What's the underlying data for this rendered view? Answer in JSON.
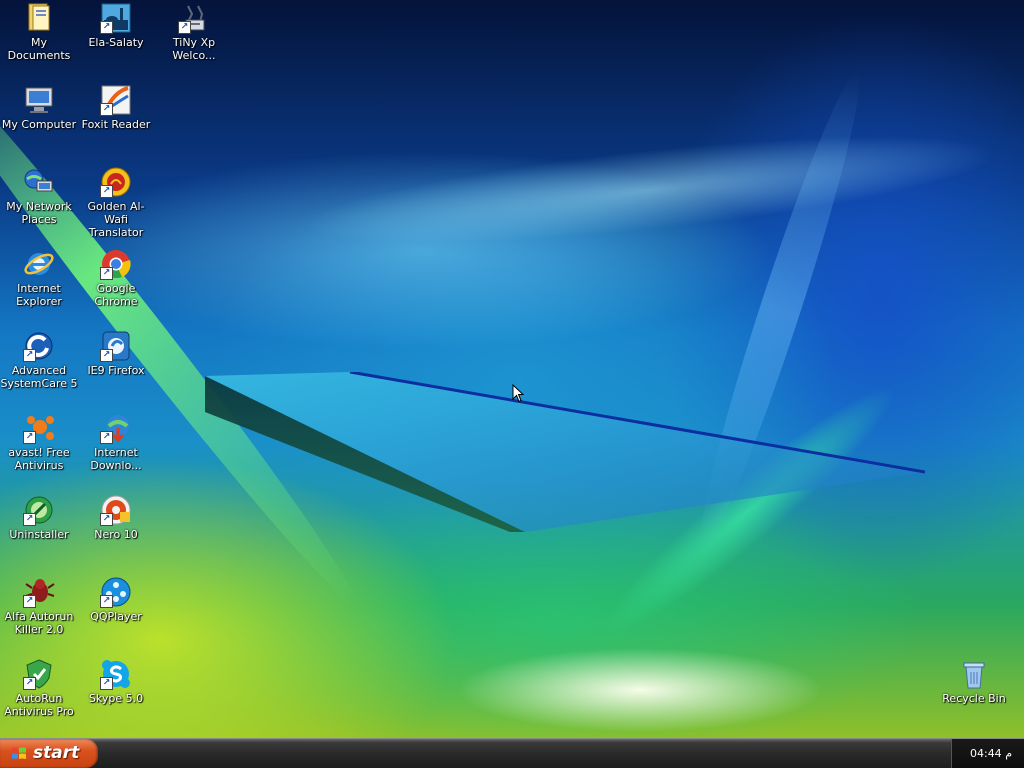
{
  "desktop": {
    "icons_col1": [
      {
        "label": "My Documents",
        "icon": "folder-documents-icon"
      },
      {
        "label": "My Computer",
        "icon": "computer-icon"
      },
      {
        "label": "My Network\nPlaces",
        "icon": "network-places-icon"
      },
      {
        "label": "Internet\nExplorer",
        "icon": "internet-explorer-icon"
      },
      {
        "label": "Advanced\nSystemCare 5",
        "icon": "advanced-systemcare-icon"
      },
      {
        "label": "avast! Free\nAntivirus",
        "icon": "avast-icon"
      },
      {
        "label": "Uninstaller",
        "icon": "uninstaller-icon"
      },
      {
        "label": "Alfa Autorun\nKiller 2.0",
        "icon": "alfa-autorun-icon"
      },
      {
        "label": "AutoRun\nAntivirus Pro",
        "icon": "autorun-antivirus-icon"
      }
    ],
    "icons_col2": [
      {
        "label": "Ela-Salaty",
        "icon": "ela-salaty-icon"
      },
      {
        "label": "Foxit Reader",
        "icon": "foxit-reader-icon"
      },
      {
        "label": "Golden Al-Wafi\nTranslator",
        "icon": "golden-alwafi-icon"
      },
      {
        "label": "Google Chrome",
        "icon": "chrome-icon"
      },
      {
        "label": "IE9 Firefox",
        "icon": "ie9-firefox-icon"
      },
      {
        "label": "Internet\nDownlo...",
        "icon": "internet-download-icon"
      },
      {
        "label": "Nero 10",
        "icon": "nero-icon"
      },
      {
        "label": "QQPlayer",
        "icon": "qqplayer-icon"
      },
      {
        "label": "Skype 5.0",
        "icon": "skype-icon"
      }
    ],
    "icons_col3": [
      {
        "label": "TiNy Xp\nWelco...",
        "icon": "tiny-xp-welcome-icon"
      }
    ],
    "recycle_bin": {
      "label": "Recycle Bin",
      "icon": "recycle-bin-icon"
    }
  },
  "taskbar": {
    "start_label": "start",
    "clock": "04:44 م"
  },
  "colors": {
    "start_button": "#d8521f",
    "taskbar": "#2a2a2a",
    "label_text": "#ffffff"
  }
}
